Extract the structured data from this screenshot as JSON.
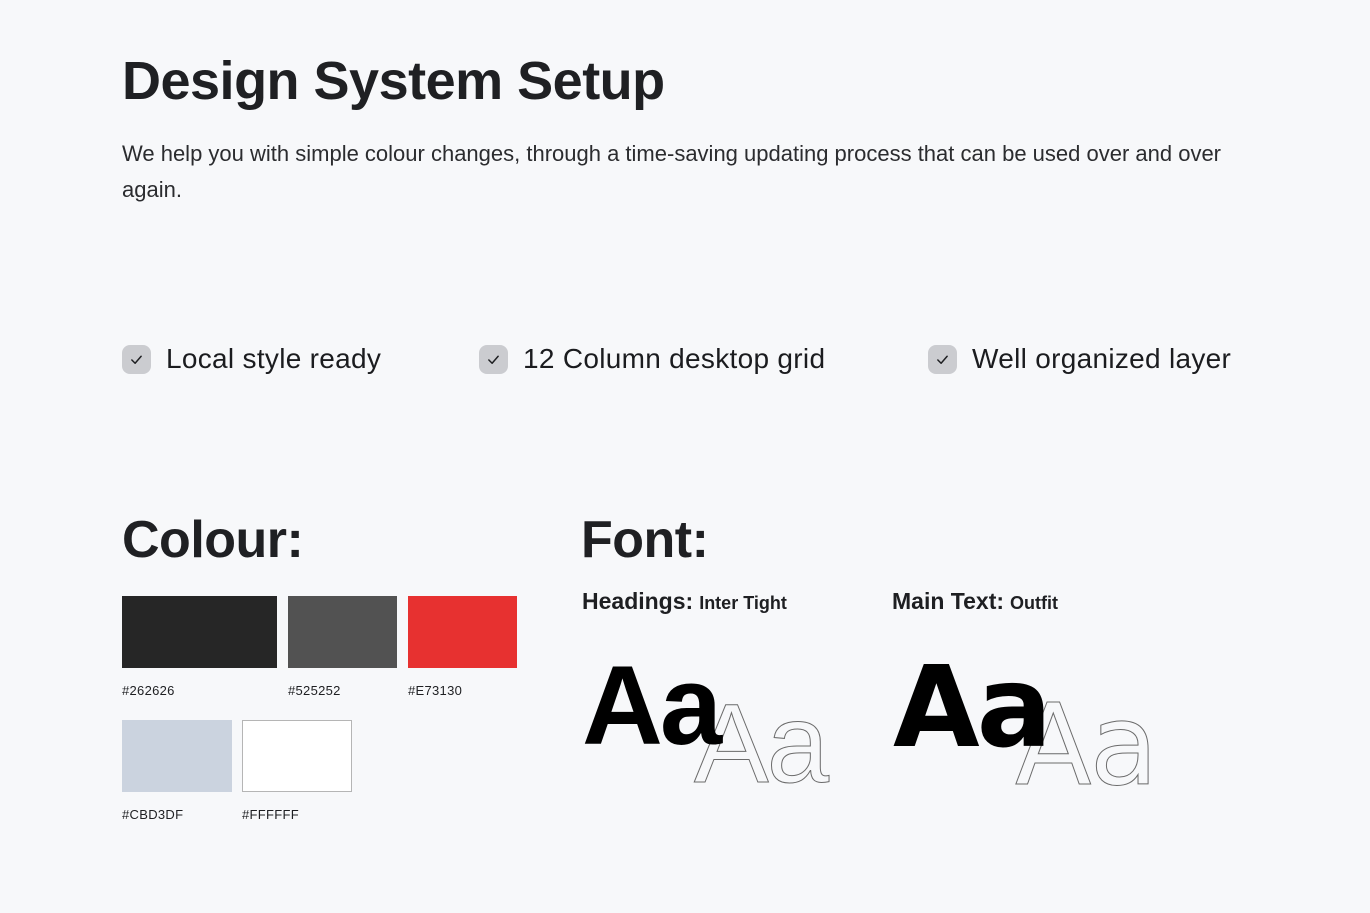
{
  "header": {
    "title": "Design System Setup",
    "intro": "We help you with simple colour changes, through a time-saving updating process that can be used over and over again."
  },
  "features": [
    {
      "label": "Local style ready",
      "icon": "check-icon",
      "checked": true
    },
    {
      "label": "12 Column desktop grid",
      "icon": "check-icon",
      "checked": true
    },
    {
      "label": "Well organized layer",
      "icon": "check-icon",
      "checked": true
    }
  ],
  "colour": {
    "title": "Colour:",
    "swatches": [
      {
        "hex": "#262626",
        "label": "#262626"
      },
      {
        "hex": "#525252",
        "label": "#525252"
      },
      {
        "hex": "#E73130",
        "label": "#E73130"
      },
      {
        "hex": "#CBD3DF",
        "label": "#CBD3DF"
      },
      {
        "hex": "#FFFFFF",
        "label": "#FFFFFF"
      }
    ]
  },
  "font": {
    "title": "Font:",
    "headings": {
      "key": "Headings:",
      "value": "Inter Tight",
      "sample": "Aa"
    },
    "main_text": {
      "key": "Main Text:",
      "value": "Outfit",
      "sample": "Aa"
    }
  }
}
